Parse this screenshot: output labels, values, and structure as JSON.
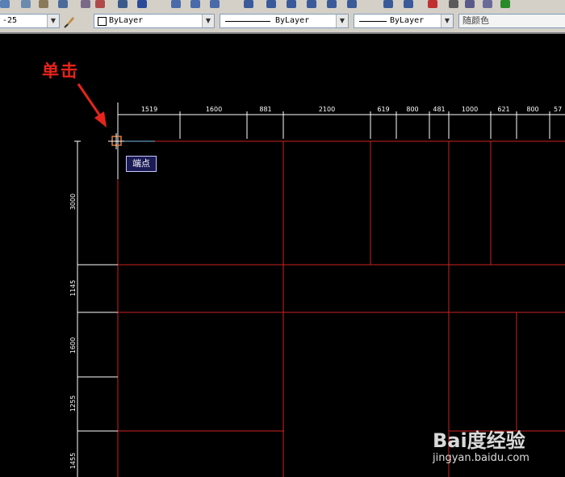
{
  "toolbar": {
    "dimstyle_value": "-25",
    "color_value": "ByLayer",
    "linetype_value": "ByLayer",
    "lineweight_value": "ByLayer",
    "plotstyle_value": "随颜色"
  },
  "annotation": {
    "text": "单击"
  },
  "tooltip": {
    "text": "端点"
  },
  "dims_top": [
    "1519",
    "1600",
    "881",
    "2100",
    "619",
    "800",
    "481",
    "1000",
    "621",
    "800",
    "57"
  ],
  "dims_left": [
    "3000",
    "1145",
    "1600",
    "1255",
    "1455"
  ],
  "watermark": {
    "logo": "Bai度经验",
    "url": "jingyan.baidu.com"
  },
  "colors": {
    "grid_line": "#cc2222",
    "dim_line": "#ffffff",
    "annotation": "#e8241b",
    "snap_marker": "#e07a3a"
  }
}
